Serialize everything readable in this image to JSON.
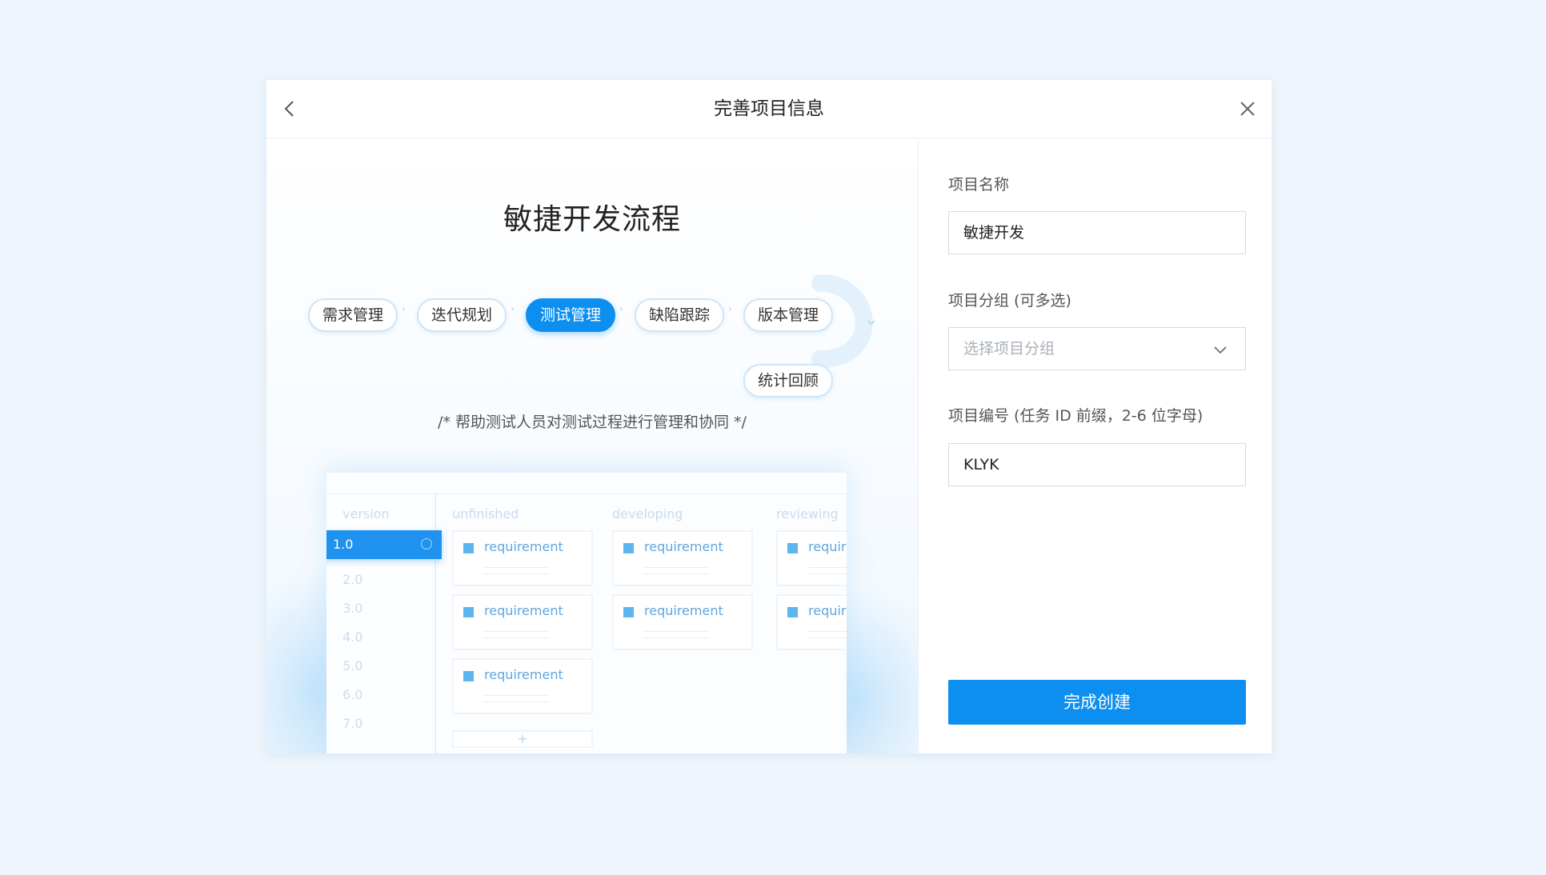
{
  "modal": {
    "title": "完善项目信息",
    "back_icon": "chevron-left-icon",
    "close_icon": "close-icon"
  },
  "flow": {
    "title": "敏捷开发流程",
    "steps": [
      "需求管理",
      "迭代规划",
      "测试管理",
      "缺陷跟踪",
      "版本管理",
      "统计回顾"
    ],
    "active_step": "测试管理",
    "description": "/* 帮助测试人员对测试过程进行管理和协同 */"
  },
  "kanban": {
    "columns": [
      "version",
      "unfinished",
      "developing",
      "reviewing"
    ],
    "versions": [
      "1.0",
      "2.0",
      "3.0",
      "4.0",
      "5.0",
      "6.0",
      "7.0"
    ],
    "active_version": "1.0",
    "card_label": "requirement",
    "truncated_label": "requir",
    "add_symbol": "+"
  },
  "form": {
    "name_label": "项目名称",
    "name_value": "敏捷开发",
    "group_label": "项目分组 (可多选)",
    "group_placeholder": "选择项目分组",
    "code_label": "项目编号 (任务 ID 前缀，2-6 位字母)",
    "code_value": "KLYK",
    "submit_label": "完成创建"
  },
  "colors": {
    "accent": "#0c8ff0",
    "background": "#eef5fc"
  }
}
